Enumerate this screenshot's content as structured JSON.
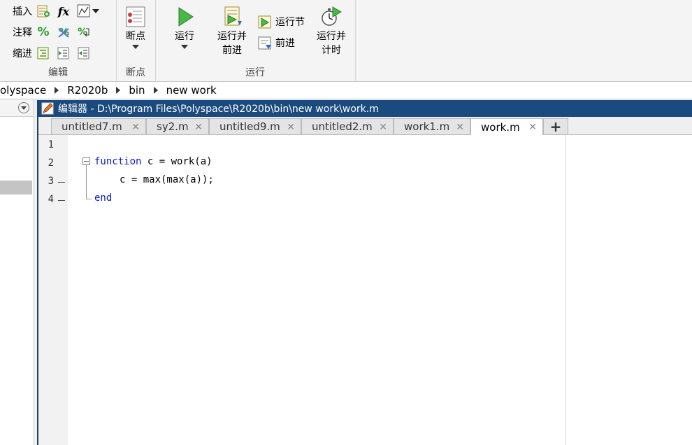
{
  "ribbon": {
    "edit_group": {
      "label": "编辑",
      "insert_label": "插入",
      "comment_label": "注释",
      "indent_label": "缩进",
      "fx_symbol": "fx",
      "percent_symbol": "%"
    },
    "breakpoint_group": {
      "label": "断点",
      "button_label": "断点"
    },
    "run_group": {
      "label": "运行",
      "run_label": "运行",
      "run_advance_label_1": "运行并",
      "run_advance_label_2": "前进",
      "run_section_label": "运行节",
      "advance_label": "前进",
      "run_time_label_1": "运行并",
      "run_time_label_2": "计时"
    }
  },
  "address_bar": {
    "segments": [
      "olyspace",
      "R2020b",
      "bin",
      "new work"
    ]
  },
  "editor": {
    "title": "编辑器 - D:\\Program Files\\Polyspace\\R2020b\\bin\\new work\\work.m",
    "tabs": [
      {
        "label": "untitled7.m"
      },
      {
        "label": "sy2.m"
      },
      {
        "label": "untitled9.m"
      },
      {
        "label": "untitled2.m"
      },
      {
        "label": "work1.m"
      },
      {
        "label": "work.m"
      }
    ],
    "close_glyph": "✕",
    "plus_glyph": "+",
    "line_numbers": [
      "1",
      "2",
      "3",
      "4"
    ],
    "code": {
      "l2_kw": "function",
      "l2_rest": " c = work(a)",
      "l3": "c = max(max(a));",
      "l4_kw": "end"
    }
  },
  "colors": {
    "title_bar": "#1b4a7f",
    "keyword": "#0e1ad8",
    "run_green": "#3aa83a"
  }
}
